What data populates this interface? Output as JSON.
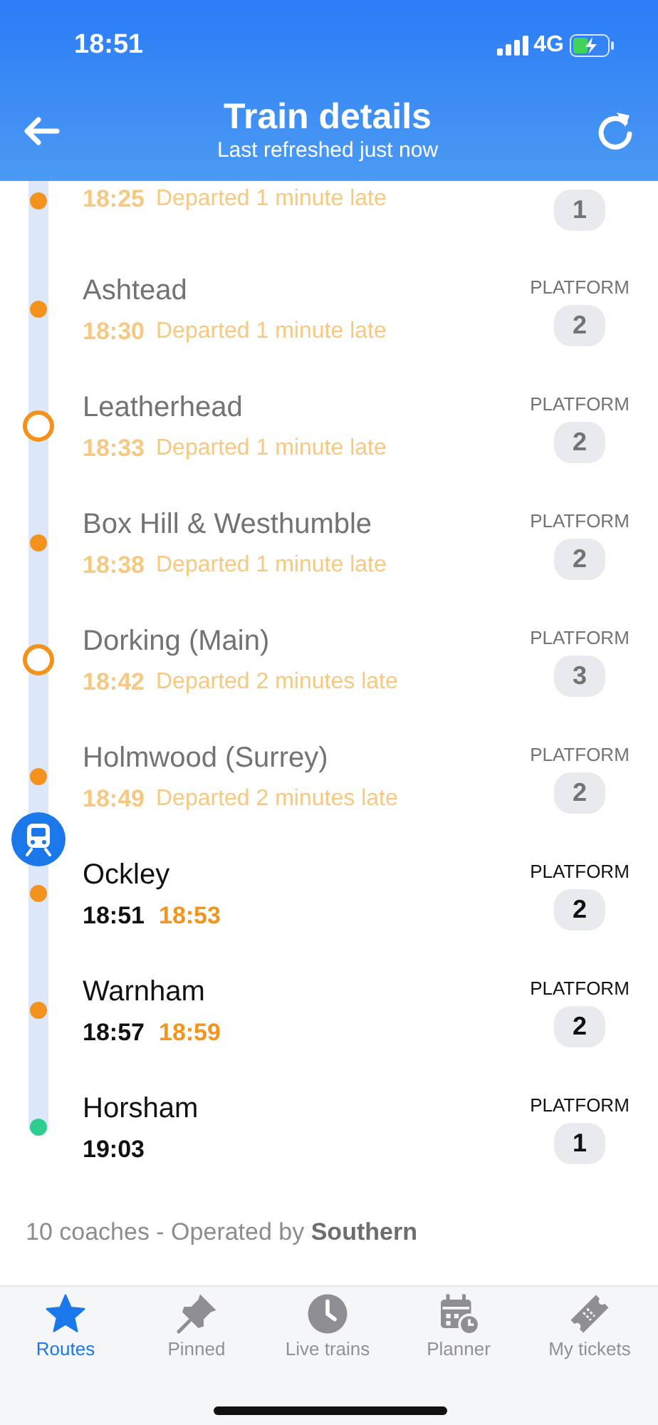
{
  "status_bar": {
    "time": "18:51",
    "network": "4G"
  },
  "header": {
    "title": "Train details",
    "subtitle": "Last refreshed just now"
  },
  "stops": [
    {
      "kind": "passed",
      "interchange": false,
      "destination": false,
      "time": "18:25",
      "status": "Departed 1 minute late",
      "platform": "1",
      "train_here": false
    },
    {
      "kind": "passed",
      "interchange": false,
      "destination": false,
      "name": "Ashtead",
      "time": "18:30",
      "status": "Departed 1 minute late",
      "platform_label": "PLATFORM",
      "platform": "2",
      "train_here": false
    },
    {
      "kind": "passed",
      "interchange": true,
      "destination": false,
      "name": "Leatherhead",
      "time": "18:33",
      "status": "Departed 1 minute late",
      "platform_label": "PLATFORM",
      "platform": "2",
      "train_here": false
    },
    {
      "kind": "passed",
      "interchange": false,
      "destination": false,
      "name": "Box Hill & Westhumble",
      "time": "18:38",
      "status": "Departed 1 minute late",
      "platform_label": "PLATFORM",
      "platform": "2",
      "train_here": false
    },
    {
      "kind": "passed",
      "interchange": true,
      "destination": false,
      "name": "Dorking (Main)",
      "time": "18:42",
      "status": "Departed 2 minutes late",
      "platform_label": "PLATFORM",
      "platform": "3",
      "train_here": false
    },
    {
      "kind": "passed",
      "interchange": false,
      "destination": false,
      "name": "Holmwood (Surrey)",
      "time": "18:49",
      "status": "Departed 2 minutes late",
      "platform_label": "PLATFORM",
      "platform": "2",
      "train_here": false
    },
    {
      "kind": "upcoming",
      "interchange": false,
      "destination": false,
      "name": "Ockley",
      "time": "18:51",
      "expected": "18:53",
      "platform_label": "PLATFORM",
      "platform": "2",
      "train_here": true
    },
    {
      "kind": "upcoming",
      "interchange": false,
      "destination": false,
      "name": "Warnham",
      "time": "18:57",
      "expected": "18:59",
      "platform_label": "PLATFORM",
      "platform": "2",
      "train_here": false
    },
    {
      "kind": "upcoming",
      "interchange": false,
      "destination": true,
      "name": "Horsham",
      "time": "19:03",
      "platform_label": "PLATFORM",
      "platform": "1",
      "train_here": false
    }
  ],
  "operator_note": "10 coaches - Operated by **Southern**",
  "tabs": [
    {
      "label": "Routes",
      "selected": true
    },
    {
      "label": "Pinned",
      "selected": false
    },
    {
      "label": "Live trains",
      "selected": false
    },
    {
      "label": "Planner",
      "selected": false
    },
    {
      "label": "My tickets",
      "selected": false
    }
  ]
}
